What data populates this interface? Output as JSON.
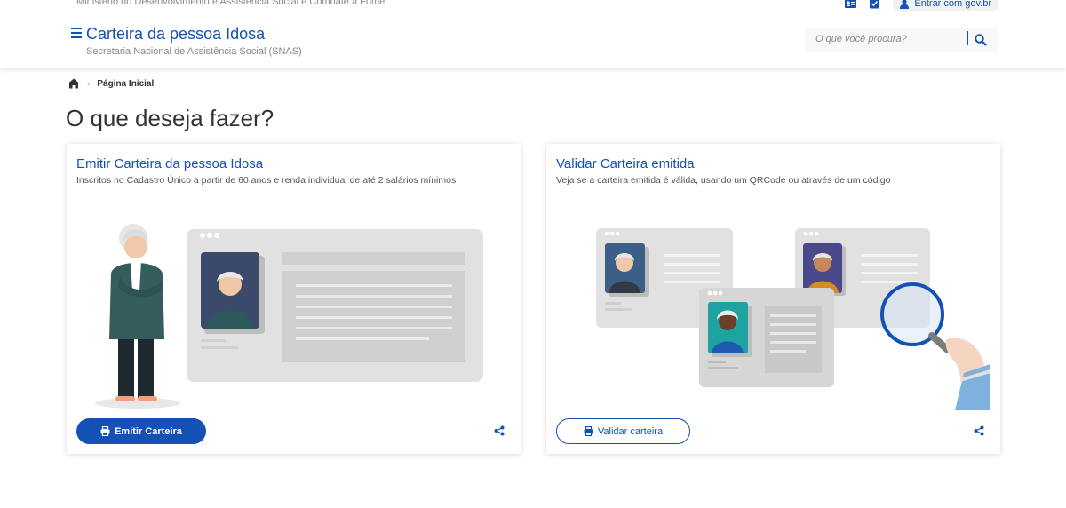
{
  "header": {
    "ministry": "Ministério do Desenvolvimento e Assistência Social e Combate à Fome",
    "title": "Carteira da pessoa Idosa",
    "subtitle": "Secretaria Nacional de Assistência Social (SNAS)",
    "login_label": "Entrar com gov.br",
    "search_placeholder": "O que você procura?"
  },
  "breadcrumb": {
    "current": "Página Inicial"
  },
  "page": {
    "title": "O que deseja fazer?"
  },
  "cards": [
    {
      "title": "Emitir Carteira da pessoa Idosa",
      "description": "Inscritos no Cadastro Único a partir de 60 anos e renda individual de até 2 salários mínimos",
      "button_label": "Emitir Carteira"
    },
    {
      "title": "Validar Carteira emitida",
      "description": "Veja se a carteira emitida é válida, usando um QRCode ou através de um código",
      "button_label": "Validar carteira"
    }
  ],
  "colors": {
    "brand": "#1351b4",
    "text": "#333333",
    "muted": "#888888"
  }
}
